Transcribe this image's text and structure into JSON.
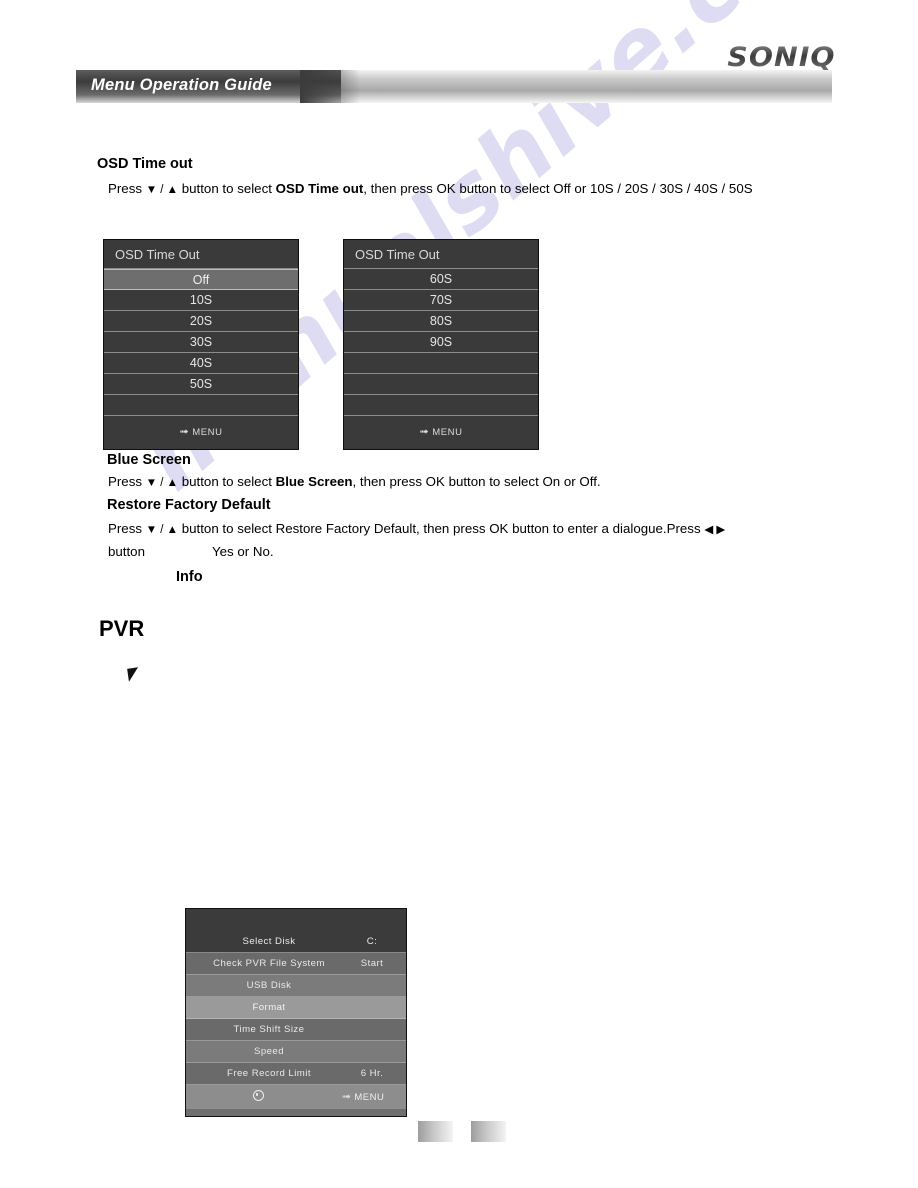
{
  "header": {
    "brand": "SONIQ",
    "title": "Menu Operation Guide"
  },
  "watermark": {
    "text": "manualshive.com",
    "color": "#c9c8ec"
  },
  "sections": {
    "osd_time_out": {
      "heading": "OSD Time out",
      "instruction_pre": "Press ",
      "instruction_arrows": "▼ / ▲",
      "instruction_mid": " button to select ",
      "instruction_bold": "OSD Time out",
      "instruction_post": ", then press OK button to select Off or 10S / 20S / 30S / 40S / 50S"
    },
    "blue_screen": {
      "heading": "Blue Screen",
      "instruction_pre": "Press ",
      "instruction_arrows": "▼ / ▲",
      "instruction_mid": " button to select ",
      "instruction_bold": "Blue Screen",
      "instruction_post": ",  then press  OK  button to select On or Off."
    },
    "restore_factory_default": {
      "heading": "Restore Factory Default",
      "instruction_pre": "Press ",
      "instruction_arrows": "▼ / ▲",
      "instruction_post": " button to select Restore Factory Default,  then press OK button to enter a dialogue.Press ",
      "instruction_arrows2": "◀ ▶",
      "line2_a": "button",
      "line2_b": "Yes or  No."
    },
    "info_label": "Info",
    "pvr_heading": "PVR"
  },
  "osd_menu_left": {
    "title": "OSD Time Out",
    "rows": [
      {
        "label": "Off",
        "selected": true
      },
      {
        "label": "10S",
        "selected": false
      },
      {
        "label": "20S",
        "selected": false
      },
      {
        "label": "30S",
        "selected": false
      },
      {
        "label": "40S",
        "selected": false
      },
      {
        "label": "50S",
        "selected": false
      },
      {
        "label": "",
        "selected": false
      }
    ],
    "footer": {
      "icon": "back-arrow-icon",
      "label": "MENU"
    }
  },
  "osd_menu_right": {
    "title": "OSD Time Out",
    "rows": [
      {
        "label": "60S",
        "selected": false
      },
      {
        "label": "70S",
        "selected": false
      },
      {
        "label": "80S",
        "selected": false
      },
      {
        "label": "90S",
        "selected": false
      },
      {
        "label": "",
        "selected": false
      },
      {
        "label": "",
        "selected": false
      },
      {
        "label": "",
        "selected": false
      }
    ],
    "footer": {
      "icon": "back-arrow-icon",
      "label": "MENU"
    }
  },
  "pvr_menu": {
    "rows": [
      {
        "label": "Select Disk",
        "value": "C:",
        "style": "dark"
      },
      {
        "label": "Check PVR File System",
        "value": "Start",
        "style": "normal"
      },
      {
        "label": "USB Disk",
        "value": "",
        "style": "alt"
      },
      {
        "label": "Format",
        "value": "",
        "style": "selected"
      },
      {
        "label": "Time Shift Size",
        "value": "",
        "style": "normal"
      },
      {
        "label": "Speed",
        "value": "",
        "style": "alt"
      },
      {
        "label": "Free Record Limit",
        "value": "6 Hr.",
        "style": "normal"
      }
    ],
    "footer": {
      "left_icon": "record-circle-icon",
      "right_icon": "back-arrow-icon",
      "right_label": "MENU"
    }
  },
  "page_footer": {
    "mark_left": "",
    "mark_right": ""
  }
}
